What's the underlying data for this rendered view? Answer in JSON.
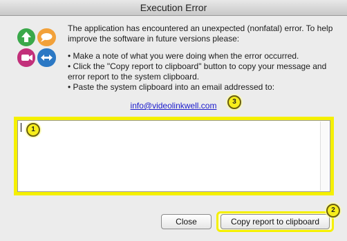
{
  "window": {
    "title": "Execution Error"
  },
  "message": {
    "intro": "The application has encountered an unexpected (nonfatal) error. To help improve the software in future versions please:",
    "bullets": [
      "• Make a note of what you were doing when the error occurred.",
      "• Click the \"Copy report to clipboard\" button to copy your message and error report to the system clipboard.",
      "• Paste the system clipboard into an email addressed to:"
    ],
    "email": "info@videolinkwell.com"
  },
  "report": {
    "value": ""
  },
  "buttons": {
    "close": "Close",
    "copy": "Copy report to clipboard"
  },
  "callouts": {
    "one": "1",
    "two": "2",
    "three": "3"
  },
  "colors": {
    "highlight": "#f5f000",
    "link": "#1a1acc"
  },
  "icons": [
    "app-logo-icon",
    "up-arrow-icon",
    "speech-bubble-icon",
    "video-camera-icon",
    "double-arrow-icon"
  ]
}
